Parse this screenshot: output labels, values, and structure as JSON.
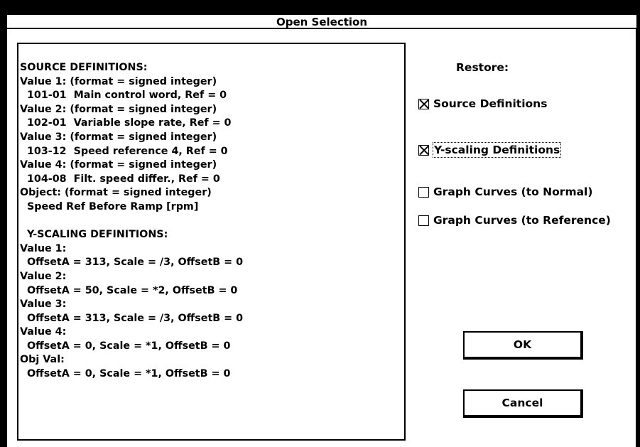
{
  "window": {
    "title": "Open Selection"
  },
  "listbox": {
    "lines": [
      "SOURCE DEFINITIONS:",
      "Value 1: (format = signed integer)",
      "  101-01  Main control word, Ref = 0",
      "Value 2: (format = signed integer)",
      "  102-01  Variable slope rate, Ref = 0",
      "Value 3: (format = signed integer)",
      "  103-12  Speed reference 4, Ref = 0",
      "Value 4: (format = signed integer)",
      "  104-08  Filt. speed differ., Ref = 0",
      "Object: (format = signed integer)",
      "  Speed Ref Before Ramp [rpm]",
      "",
      "  Y-SCALING DEFINITIONS:",
      "Value 1:",
      "  OffsetA = 313, Scale = /3, OffsetB = 0",
      "Value 2:",
      "  OffsetA = 50, Scale = *2, OffsetB = 0",
      "Value 3:",
      "  OffsetA = 313, Scale = /3, OffsetB = 0",
      "Value 4:",
      "  OffsetA = 0, Scale = *1, OffsetB = 0",
      "Obj Val:",
      "  OffsetA = 0, Scale = *1, OffsetB = 0"
    ]
  },
  "restore": {
    "label": "Restore:",
    "options": [
      {
        "label": "Source Definitions",
        "checked": true
      },
      {
        "label": "Y-scaling Definitions",
        "checked": true
      },
      {
        "label": "Graph Curves (to Normal)",
        "checked": false
      },
      {
        "label": "Graph Curves (to Reference)",
        "checked": false
      }
    ]
  },
  "buttons": {
    "ok": "OK",
    "cancel": "Cancel"
  }
}
